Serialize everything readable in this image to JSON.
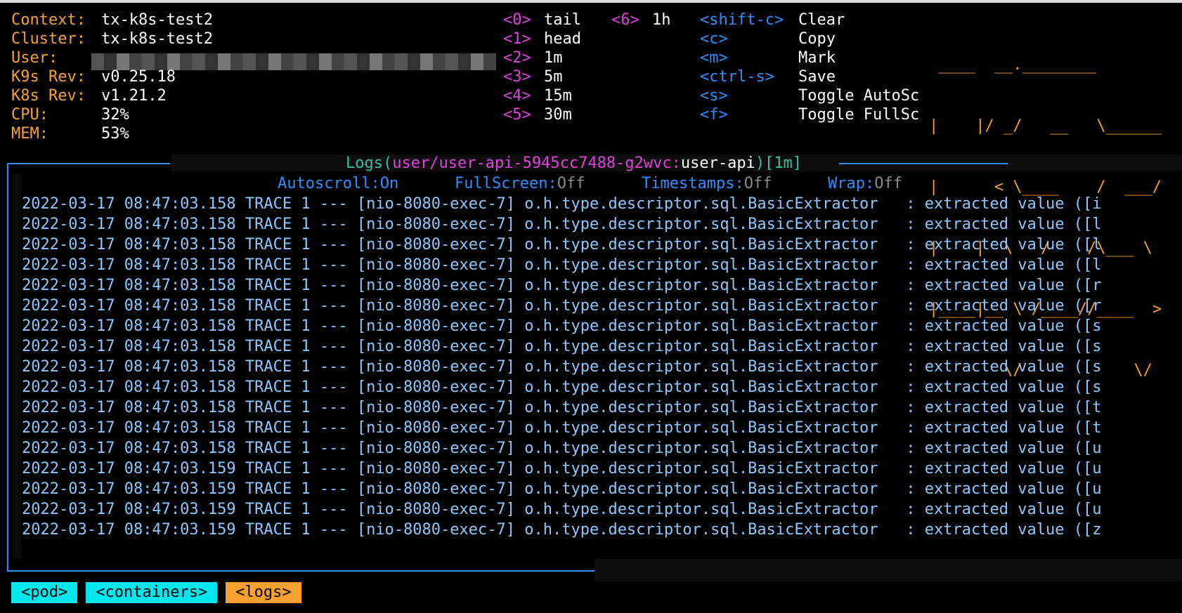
{
  "info": [
    {
      "key": "Context:",
      "value": "tx-k8s-test2"
    },
    {
      "key": "Cluster:",
      "value": "tx-k8s-test2"
    },
    {
      "key": "User:",
      "value": ""
    },
    {
      "key": "K9s Rev:",
      "value": "v0.25.18"
    },
    {
      "key": "K8s Rev:",
      "value": "v1.21.2"
    },
    {
      "key": "CPU:",
      "value": "32%"
    },
    {
      "key": "MEM:",
      "value": "53%"
    }
  ],
  "hotkeys_left": [
    {
      "key": "<0>",
      "label": "tail"
    },
    {
      "key": "<1>",
      "label": "head"
    },
    {
      "key": "<2>",
      "label": "1m"
    },
    {
      "key": "<3>",
      "label": "5m"
    },
    {
      "key": "<4>",
      "label": "15m"
    },
    {
      "key": "<5>",
      "label": "30m"
    }
  ],
  "hotkeys_mid": [
    {
      "key": "<6>",
      "label": "1h"
    }
  ],
  "hotkeys_right": [
    {
      "key": "<shift-c>",
      "label": "Clear"
    },
    {
      "key": "<c>",
      "label": "Copy"
    },
    {
      "key": "<m>",
      "label": "Mark"
    },
    {
      "key": "<ctrl-s>",
      "label": "Save"
    },
    {
      "key": "<s>",
      "label": "Toggle AutoSc"
    },
    {
      "key": "<f>",
      "label": "Toggle FullSc"
    }
  ],
  "logo_lines": [
    " ____  __.________       ",
    "|    |/ _/   __   \\______",
    "|      < \\____    /  ___/",
    "|    |  \\   /    /\\___ \\ ",
    "|____|__ \\ /____//____  >",
    "        \\/            \\/ "
  ],
  "title": {
    "prefix": "Logs(",
    "pod": "user/user-api-5945cc7488-g2wvc:",
    "container": "user-api",
    "mid": ")[",
    "since": "1m",
    "suffix": "]"
  },
  "status": [
    {
      "key": "Autoscroll:",
      "value": "On",
      "on": true
    },
    {
      "key": "FullScreen:",
      "value": "Off",
      "on": false
    },
    {
      "key": "Timestamps:",
      "value": "Off",
      "on": false
    },
    {
      "key": "Wrap:",
      "value": "Off",
      "on": false
    }
  ],
  "logs": [
    "2022-03-17 08:47:03.158 TRACE 1 --- [nio-8080-exec-7] o.h.type.descriptor.sql.BasicExtractor   : extracted value ([i",
    "2022-03-17 08:47:03.158 TRACE 1 --- [nio-8080-exec-7] o.h.type.descriptor.sql.BasicExtractor   : extracted value ([l",
    "2022-03-17 08:47:03.158 TRACE 1 --- [nio-8080-exec-7] o.h.type.descriptor.sql.BasicExtractor   : extracted value ([l",
    "2022-03-17 08:47:03.158 TRACE 1 --- [nio-8080-exec-7] o.h.type.descriptor.sql.BasicExtractor   : extracted value ([l",
    "2022-03-17 08:47:03.158 TRACE 1 --- [nio-8080-exec-7] o.h.type.descriptor.sql.BasicExtractor   : extracted value ([r",
    "2022-03-17 08:47:03.158 TRACE 1 --- [nio-8080-exec-7] o.h.type.descriptor.sql.BasicExtractor   : extracted value ([r",
    "2022-03-17 08:47:03.158 TRACE 1 --- [nio-8080-exec-7] o.h.type.descriptor.sql.BasicExtractor   : extracted value ([s",
    "2022-03-17 08:47:03.158 TRACE 1 --- [nio-8080-exec-7] o.h.type.descriptor.sql.BasicExtractor   : extracted value ([s",
    "2022-03-17 08:47:03.158 TRACE 1 --- [nio-8080-exec-7] o.h.type.descriptor.sql.BasicExtractor   : extracted value ([s",
    "2022-03-17 08:47:03.158 TRACE 1 --- [nio-8080-exec-7] o.h.type.descriptor.sql.BasicExtractor   : extracted value ([s",
    "2022-03-17 08:47:03.158 TRACE 1 --- [nio-8080-exec-7] o.h.type.descriptor.sql.BasicExtractor   : extracted value ([t",
    "2022-03-17 08:47:03.158 TRACE 1 --- [nio-8080-exec-7] o.h.type.descriptor.sql.BasicExtractor   : extracted value ([t",
    "2022-03-17 08:47:03.158 TRACE 1 --- [nio-8080-exec-7] o.h.type.descriptor.sql.BasicExtractor   : extracted value ([u",
    "2022-03-17 08:47:03.159 TRACE 1 --- [nio-8080-exec-7] o.h.type.descriptor.sql.BasicExtractor   : extracted value ([u",
    "2022-03-17 08:47:03.159 TRACE 1 --- [nio-8080-exec-7] o.h.type.descriptor.sql.BasicExtractor   : extracted value ([u",
    "2022-03-17 08:47:03.159 TRACE 1 --- [nio-8080-exec-7] o.h.type.descriptor.sql.BasicExtractor   : extracted value ([u",
    "2022-03-17 08:47:03.159 TRACE 1 --- [nio-8080-exec-7] o.h.type.descriptor.sql.BasicExtractor   : extracted value ([z"
  ],
  "breadcrumbs": [
    {
      "label": "<pod>",
      "active": false
    },
    {
      "label": "<containers>",
      "active": false
    },
    {
      "label": "<logs>",
      "active": true
    }
  ],
  "colors": {
    "accent_orange": "#f9a12e",
    "accent_blue": "#2f8fff",
    "hotkey_magenta": "#e040e0",
    "log_text": "#8ec7ff",
    "crumb_cyan": "#00e5ee",
    "title_teal": "#35c0a0"
  }
}
